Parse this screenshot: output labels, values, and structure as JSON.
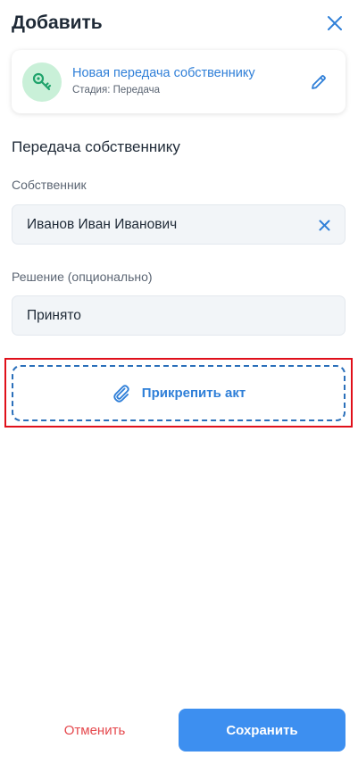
{
  "header": {
    "title": "Добавить",
    "close_icon": "close-icon"
  },
  "card": {
    "icon": "key-icon",
    "title": "Новая передача собственнику",
    "subtitle": "Стадия: Передача",
    "edit_icon": "pencil-icon"
  },
  "section": {
    "title": "Передача собственнику"
  },
  "fields": {
    "owner": {
      "label": "Собственник",
      "value": "Иванов Иван Иванович",
      "clear_icon": "close-icon"
    },
    "decision": {
      "label": "Решение (опционально)",
      "value": "Принято"
    }
  },
  "attach": {
    "icon": "paperclip-icon",
    "label": "Прикрепить акт"
  },
  "footer": {
    "cancel_label": "Отменить",
    "save_label": "Сохранить"
  },
  "colors": {
    "accent": "#3d8ff0",
    "link": "#2f7fd8",
    "danger": "#e5484d",
    "highlight": "#e0101a",
    "icon_bg": "#c9f0d8",
    "icon_fg": "#1fa36b"
  }
}
